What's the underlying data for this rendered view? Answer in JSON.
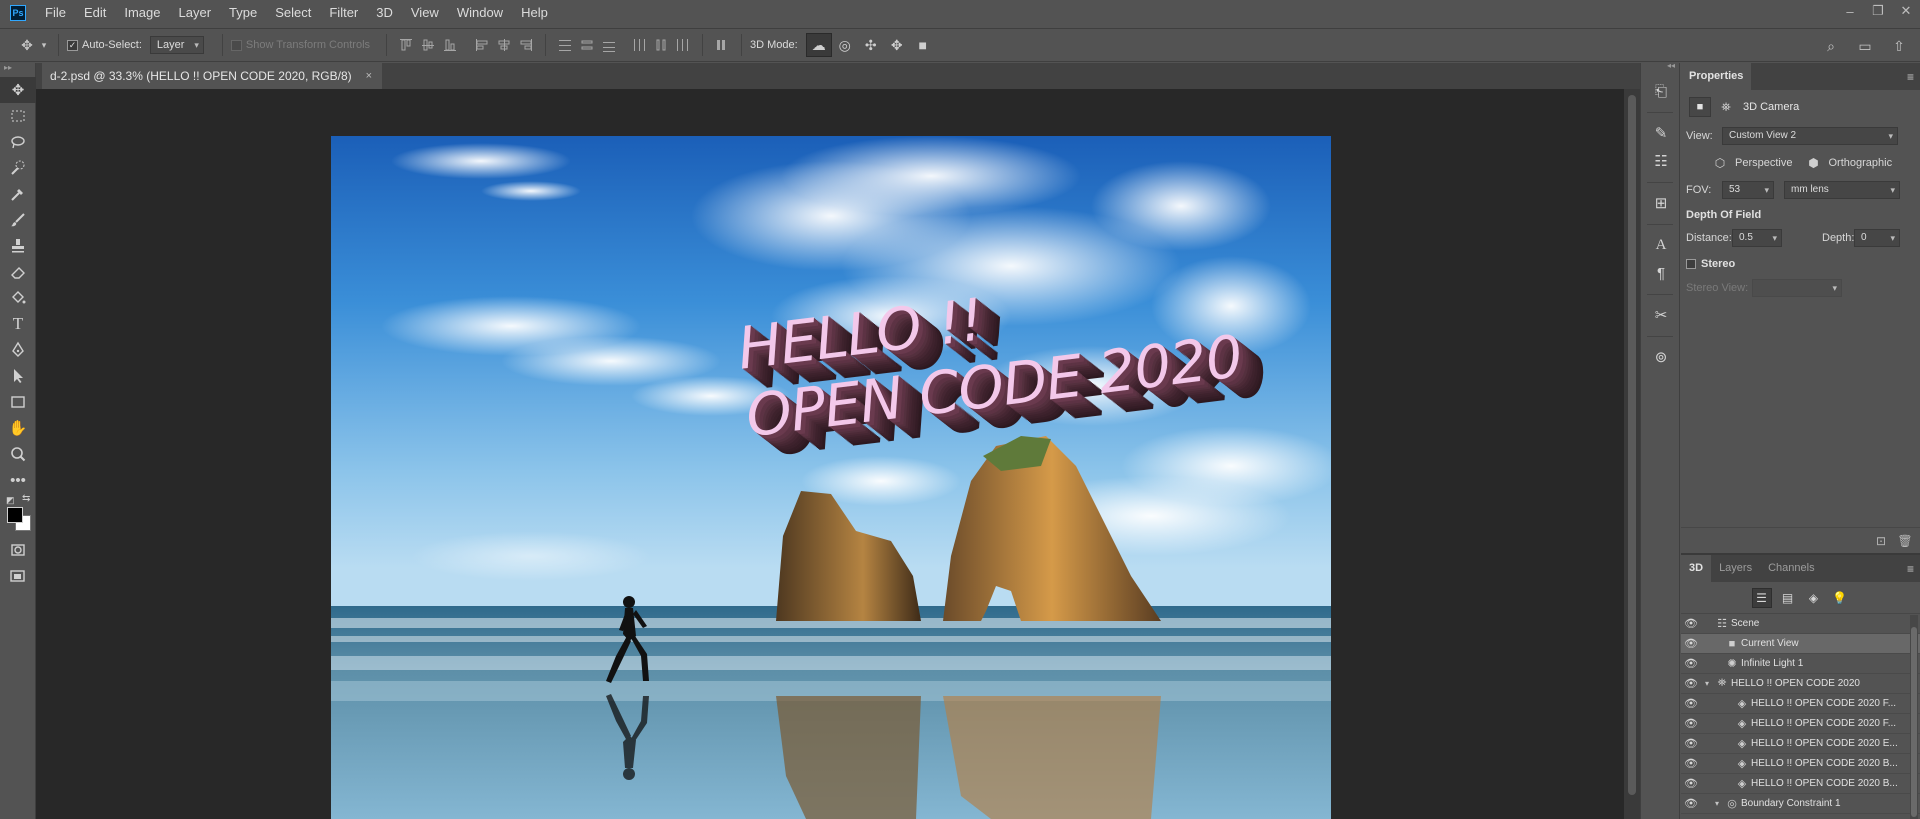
{
  "app": {
    "logo": "Ps"
  },
  "menubar": {
    "items": [
      "File",
      "Edit",
      "Image",
      "Layer",
      "Type",
      "Select",
      "Filter",
      "3D",
      "View",
      "Window",
      "Help"
    ]
  },
  "window_controls": {
    "minimize": "‒",
    "restore": "❐",
    "close": "✕"
  },
  "options": {
    "auto_select_label": "Auto-Select:",
    "auto_select_checked": true,
    "auto_select_target": "Layer",
    "show_transform_label": "Show Transform Controls",
    "mode3d_label": "3D Mode:"
  },
  "document": {
    "tab_title": "d-2.psd @ 33.3% (HELLO !! OPEN CODE 2020, RGB/8)",
    "tab_close": "×",
    "text_line1": "HELLO !!",
    "text_line2": "OPEN CODE 2020"
  },
  "properties": {
    "tabs": [
      "Properties"
    ],
    "menu_icon": "≡",
    "object_type": "3D Camera",
    "view_label": "View:",
    "view_value": "Custom View 2",
    "perspective_label": "Perspective",
    "orthographic_label": "Orthographic",
    "fov_label": "FOV:",
    "fov_value": "53",
    "fov_unit": "mm lens",
    "dof_heading": "Depth Of Field",
    "distance_label": "Distance:",
    "distance_value": "0.5",
    "depth_label": "Depth:",
    "depth_value": "0",
    "stereo_label": "Stereo",
    "stereo_checked": false,
    "stereo_view_label": "Stereo View:",
    "stereo_view_value": ""
  },
  "panel3d": {
    "tabs": [
      "3D",
      "Layers",
      "Channels"
    ],
    "active_tab": "3D",
    "menu_icon": "≡",
    "scene_items": [
      {
        "label": "Scene",
        "icon": "scene-icon",
        "indent": 0,
        "selected": false,
        "twisty": ""
      },
      {
        "label": "Current View",
        "icon": "camera-icon",
        "indent": 1,
        "selected": true,
        "twisty": ""
      },
      {
        "label": "Infinite Light 1",
        "icon": "light-icon",
        "indent": 1,
        "selected": false,
        "twisty": ""
      },
      {
        "label": "HELLO !! OPEN CODE 2020",
        "icon": "mesh-icon",
        "indent": 0,
        "selected": false,
        "twisty": "▾"
      },
      {
        "label": "HELLO !! OPEN CODE 2020 F...",
        "icon": "material-icon",
        "indent": 2,
        "selected": false,
        "twisty": ""
      },
      {
        "label": "HELLO !! OPEN CODE 2020 F...",
        "icon": "material-icon",
        "indent": 2,
        "selected": false,
        "twisty": ""
      },
      {
        "label": "HELLO !! OPEN CODE 2020 E...",
        "icon": "material-icon",
        "indent": 2,
        "selected": false,
        "twisty": ""
      },
      {
        "label": "HELLO !! OPEN CODE 2020 B...",
        "icon": "material-icon",
        "indent": 2,
        "selected": false,
        "twisty": ""
      },
      {
        "label": "HELLO !! OPEN CODE 2020 B...",
        "icon": "material-icon",
        "indent": 2,
        "selected": false,
        "twisty": ""
      },
      {
        "label": "Boundary Constraint 1",
        "icon": "constraint-icon",
        "indent": 1,
        "selected": false,
        "twisty": "▾"
      }
    ]
  },
  "colors": {
    "accent": "#31a8ff",
    "panel_bg": "#535353",
    "canvas_bg": "#282828",
    "text_3d": "#f3c8ea"
  }
}
